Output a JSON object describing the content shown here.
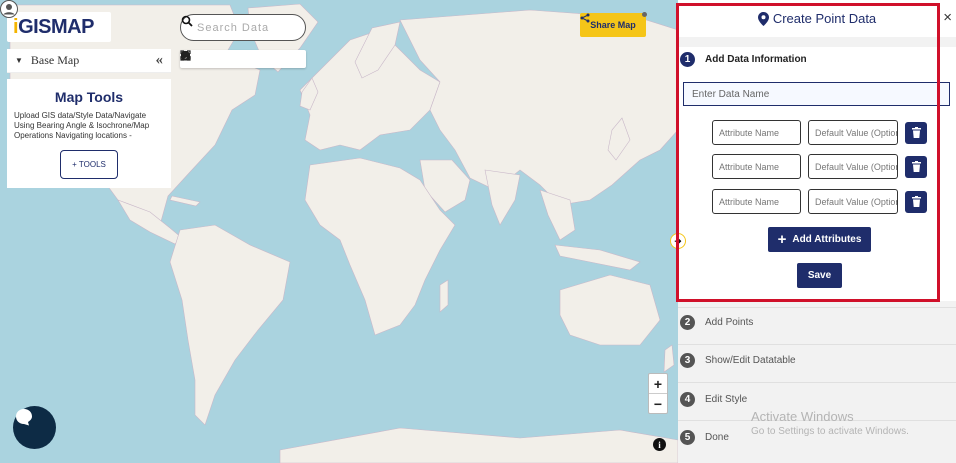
{
  "app": {
    "logo_i": "i",
    "logo_rest": "GISMAP"
  },
  "search": {
    "placeholder": "Search Data"
  },
  "toolbar": {
    "icons": [
      "locate-icon",
      "fullscreen-icon",
      "print-icon",
      "zoom-search-icon",
      "measure-icon",
      "layers-icon"
    ]
  },
  "basemap": {
    "label": "Base Map",
    "collapse": "«"
  },
  "tools_card": {
    "title": "Map Tools",
    "description": "Upload GIS data/Style Data/Navigate Using Bearing Angle & Isochrone/Map Operations Navigating locations -",
    "button": "+ TOOLS"
  },
  "share": {
    "label": "Share Map"
  },
  "zoom": {
    "in": "+",
    "out": "−"
  },
  "info": {
    "label": "i"
  },
  "panel": {
    "title": "Create Point Data",
    "close": "×",
    "steps": [
      {
        "num": "1",
        "label": "Add Data Information"
      },
      {
        "num": "2",
        "label": "Add Points"
      },
      {
        "num": "3",
        "label": "Show/Edit Datatable"
      },
      {
        "num": "4",
        "label": "Edit Style"
      },
      {
        "num": "5",
        "label": "Done"
      }
    ],
    "data_name_placeholder": "Enter Data Name",
    "attributes": [
      {
        "name_placeholder": "Attribute Name",
        "value_placeholder": "Default Value (Optional)"
      },
      {
        "name_placeholder": "Attribute Name",
        "value_placeholder": "Default Value (Optional)"
      },
      {
        "name_placeholder": "Attribute Name",
        "value_placeholder": "Default Value (Optional)"
      }
    ],
    "add_attributes": "Add Attributes",
    "save": "Save"
  },
  "watermark": {
    "line1": "Activate Windows",
    "line2": "Go to Settings to activate Windows."
  },
  "colors": {
    "brand_navy": "#1f2d6b",
    "accent_yellow": "#f5c518",
    "highlight_red": "#d0102a",
    "water": "#aad3df",
    "land": "#f2efe9"
  }
}
